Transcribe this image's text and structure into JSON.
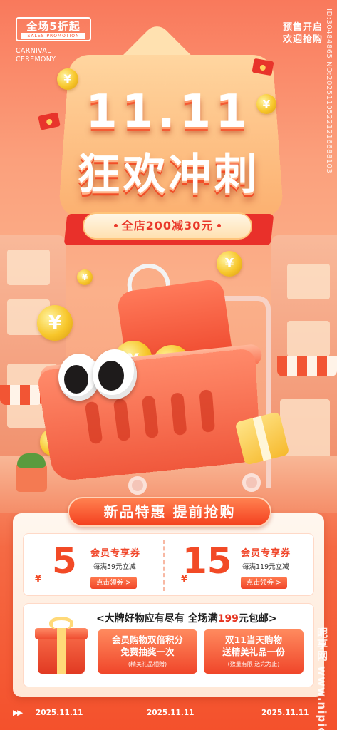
{
  "header": {
    "logo_main": "全场5折起",
    "logo_sub": "SALES PROMOTION",
    "carnival_1": "CARNIVAL",
    "carnival_2": "CEREMONY",
    "presale_1": "预售开启",
    "presale_2": "欢迎抢购",
    "side_id": "ID:30484865 NO:20251105221216688103"
  },
  "hero": {
    "date_title": "11.11",
    "main_title": "狂欢冲刺",
    "ribbon_text": "全店200减30元",
    "coin_symbol": "¥"
  },
  "section": {
    "title": "新品特惠 提前抢购"
  },
  "coupons": [
    {
      "currency": "¥",
      "amount": "5",
      "title": "会员专享券",
      "rule": "每满59元立减",
      "button": "点击领券 >"
    },
    {
      "currency": "¥",
      "amount": "15",
      "title": "会员专享券",
      "rule": "每满119元立减",
      "button": "点击领券 >"
    }
  ],
  "promo": {
    "head_pre": "<大牌好物应有尽有 全场满",
    "head_num": "199",
    "head_post": "元包邮>",
    "boxes": [
      {
        "line1": "会员购物双倍积分",
        "line2": "免费抽奖一次",
        "line3": "(精美礼品相赠)"
      },
      {
        "line1": "双11当天购物",
        "line2": "送精美礼品一份",
        "line3": "(数量有限 送完为止)"
      }
    ]
  },
  "footer": {
    "arrows": "▶▶",
    "date1": "2025.11.11",
    "date2": "2025.11.11",
    "date3": "2025.11.11"
  },
  "watermark": {
    "text": "昵享网 www.nipic.com"
  },
  "colors": {
    "accent": "#f4512c",
    "coupon_red": "#f24a26",
    "gold": "#f7c62a"
  }
}
